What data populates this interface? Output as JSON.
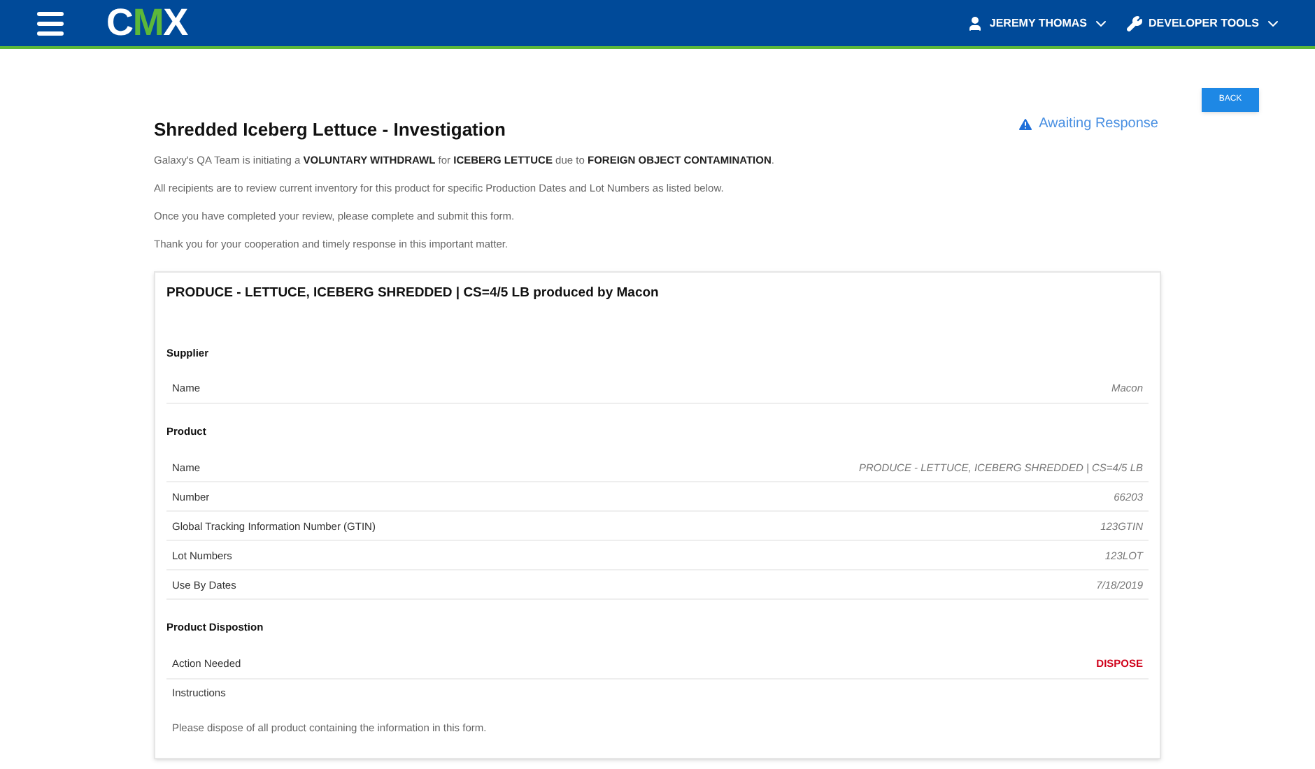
{
  "header": {
    "logo": "CMX",
    "user": "JEREMY THOMAS",
    "tools": "DEVELOPER TOOLS"
  },
  "back_button": "BACK",
  "title": "Shredded Iceberg Lettuce - Investigation",
  "status": "Awaiting Response",
  "paragraphs": [
    "Galaxy's QA Team is initiating a **VOLUNTARY WITHDRAWL** for **ICEBERG LETTUCE** due to **FOREIGN OBJECT CONTAMINATION**.",
    "All recipients are to review current inventory for this product for specific Production Dates and Lot Numbers as listed below.",
    "Once you have completed your review, please complete and submit this form.",
    "Thank you for your cooperation and timely response in this important matter."
  ],
  "card": {
    "title": "**PRODUCE - LETTUCE, ICEBERG SHREDDED | CS=4/5 LB** produced by **Macon**",
    "sections": [
      {
        "heading": "Supplier",
        "rows": [
          {
            "label": "Name",
            "value": "Macon",
            "kind": "plain"
          }
        ]
      },
      {
        "heading": "Product",
        "rows": [
          {
            "label": "Name",
            "value": "PRODUCE - LETTUCE, ICEBERG SHREDDED | CS=4/5 LB",
            "kind": "plain"
          },
          {
            "label": "Number",
            "value": "66203",
            "kind": "plain"
          },
          {
            "label": "Global Tracking Information Number (GTIN)",
            "value": "123GTIN",
            "kind": "plain"
          },
          {
            "label": "Lot Numbers",
            "value": "123LOT",
            "kind": "plain"
          },
          {
            "label": "Use By Dates",
            "value": "7/18/2019",
            "kind": "plain"
          }
        ]
      },
      {
        "heading": "Product Dispostion",
        "rows": [
          {
            "label": "Action Needed",
            "value": "DISPOSE",
            "kind": "alert"
          },
          {
            "label": "Instructions"
          }
        ],
        "note": "Please dispose of all product containing the information in this form."
      }
    ]
  }
}
